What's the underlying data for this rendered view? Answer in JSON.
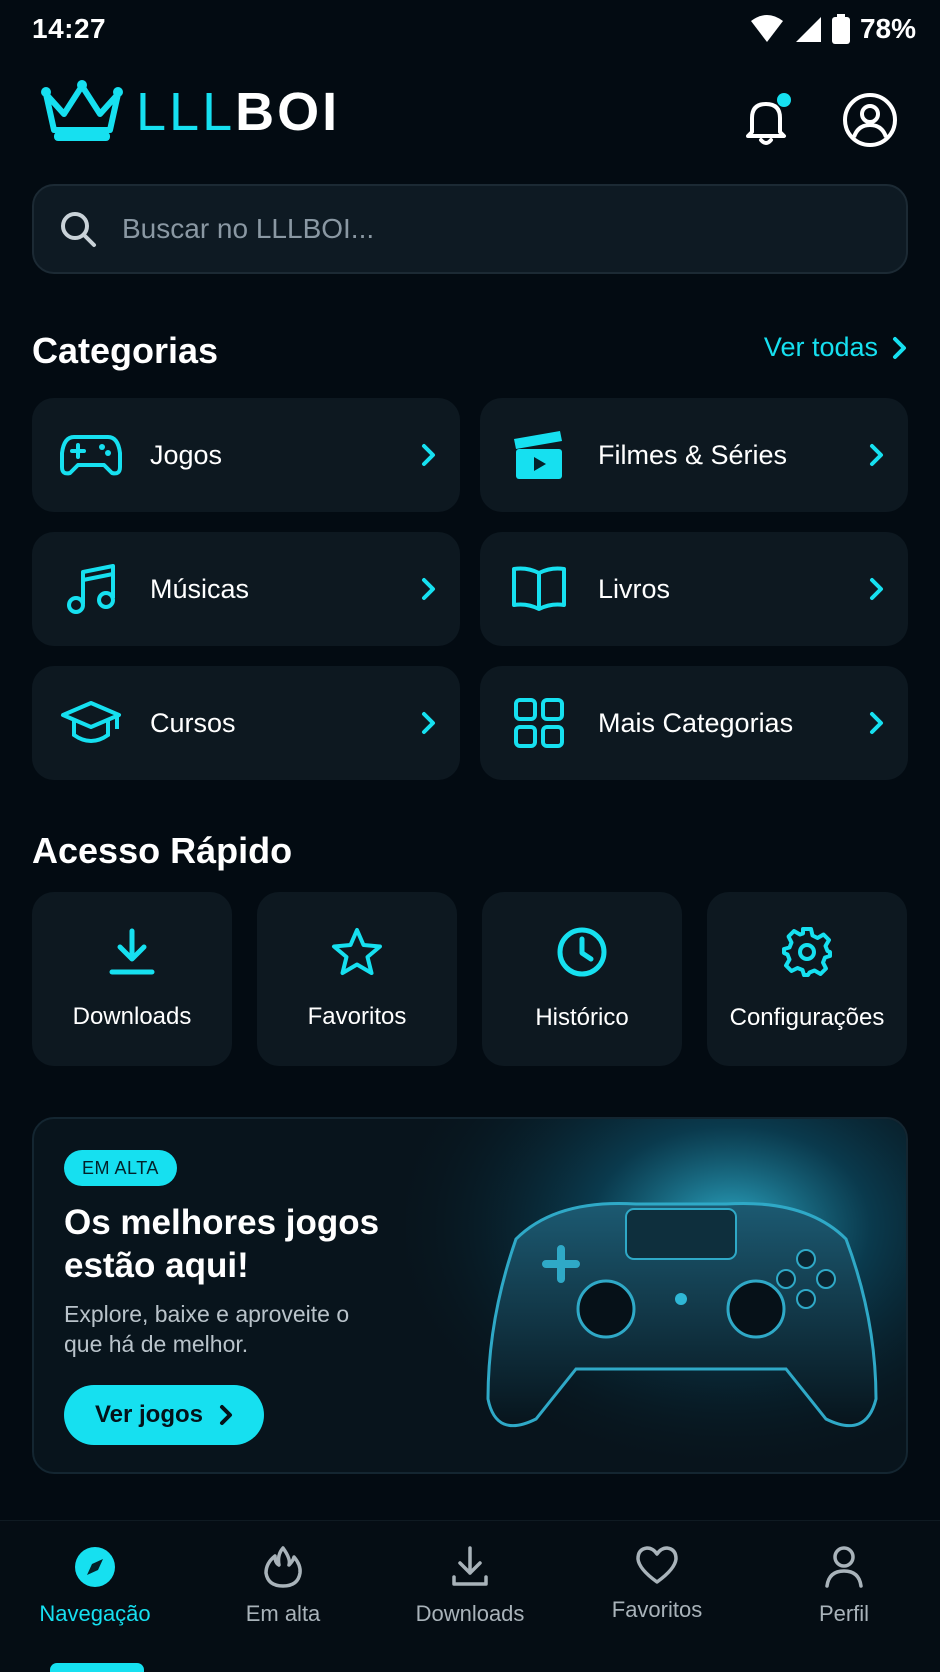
{
  "status_bar": {
    "time": "14:27",
    "battery": "78%"
  },
  "header": {
    "logo_part1": "LLL",
    "logo_part2": "BOI"
  },
  "search": {
    "placeholder": "Buscar no LLLBOI..."
  },
  "categories": {
    "title": "Categorias",
    "see_all": "Ver todas",
    "items": [
      {
        "label": "Jogos",
        "icon": "gamepad-icon"
      },
      {
        "label": "Filmes & Séries",
        "icon": "clapperboard-icon"
      },
      {
        "label": "Músicas",
        "icon": "music-note-icon"
      },
      {
        "label": "Livros",
        "icon": "book-icon"
      },
      {
        "label": "Cursos",
        "icon": "graduation-cap-icon"
      },
      {
        "label": "Mais Categorias",
        "icon": "grid-icon"
      }
    ]
  },
  "quick_access": {
    "title": "Acesso Rápido",
    "items": [
      {
        "label": "Downloads",
        "icon": "download-icon"
      },
      {
        "label": "Favoritos",
        "icon": "star-icon"
      },
      {
        "label": "Histórico",
        "icon": "clock-icon"
      },
      {
        "label": "Configurações",
        "icon": "gear-icon"
      }
    ]
  },
  "promo": {
    "badge": "EM ALTA",
    "title": "Os melhores jogos estão aqui!",
    "subtitle": "Explore, baixe e aproveite o que há de melhor.",
    "cta": "Ver jogos"
  },
  "bottom_nav": {
    "items": [
      {
        "label": "Navegação",
        "icon": "compass-icon",
        "active": true
      },
      {
        "label": "Em alta",
        "icon": "flame-icon",
        "active": false
      },
      {
        "label": "Downloads",
        "icon": "download-icon",
        "active": false
      },
      {
        "label": "Favoritos",
        "icon": "heart-icon",
        "active": false
      },
      {
        "label": "Perfil",
        "icon": "person-icon",
        "active": false
      }
    ]
  },
  "colors": {
    "accent": "#16e0f0",
    "background": "#030b12",
    "card": "#0d1820"
  }
}
